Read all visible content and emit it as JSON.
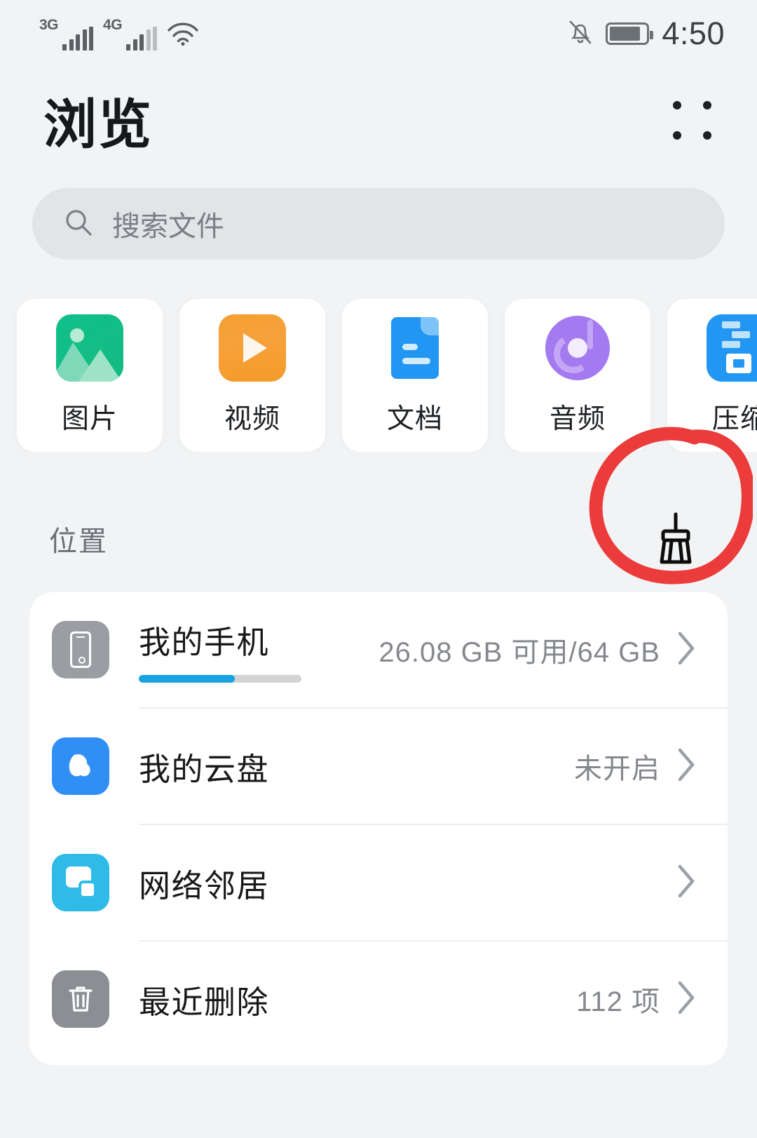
{
  "status_bar": {
    "network_3g": "3G",
    "network_4g": "4G",
    "wifi_icon": "wifi-icon",
    "mute_icon": "bell-muted-icon",
    "battery_icon": "battery-icon",
    "time": "4:50"
  },
  "header": {
    "title": "浏览",
    "menu_icon": "grid-dots-menu-icon"
  },
  "search": {
    "icon": "search-icon",
    "placeholder": "搜索文件",
    "value": ""
  },
  "categories": [
    {
      "label": "图片",
      "icon": "image-icon",
      "color": "#13bd86"
    },
    {
      "label": "视频",
      "icon": "video-play-icon",
      "color": "#f5a033"
    },
    {
      "label": "文档",
      "icon": "document-icon",
      "color": "#2196f3"
    },
    {
      "label": "音频",
      "icon": "audio-disc-icon",
      "color": "#a47af0"
    },
    {
      "label": "压缩",
      "icon": "zip-archive-icon",
      "color": "#2196f3"
    }
  ],
  "locations_section": {
    "title": "位置",
    "cleanup_icon": "broom-cleanup-icon",
    "annotation": {
      "shape": "circle",
      "color": "#eb3b3b",
      "target": "broom-cleanup-icon"
    }
  },
  "locations": [
    {
      "name": "我的手机",
      "icon": "phone-icon",
      "value": "26.08 GB 可用/64 GB",
      "storage_used_percent": 59,
      "bar_color": "#18a2e0",
      "chevron": "chevron-right-icon"
    },
    {
      "name": "我的云盘",
      "icon": "cloud-drive-icon",
      "value": "未开启",
      "chevron": "chevron-right-icon"
    },
    {
      "name": "网络邻居",
      "icon": "network-neighbor-icon",
      "value": "",
      "chevron": "chevron-right-icon"
    },
    {
      "name": "最近删除",
      "icon": "trash-icon",
      "value": "112 项",
      "chevron": "chevron-right-icon"
    }
  ]
}
